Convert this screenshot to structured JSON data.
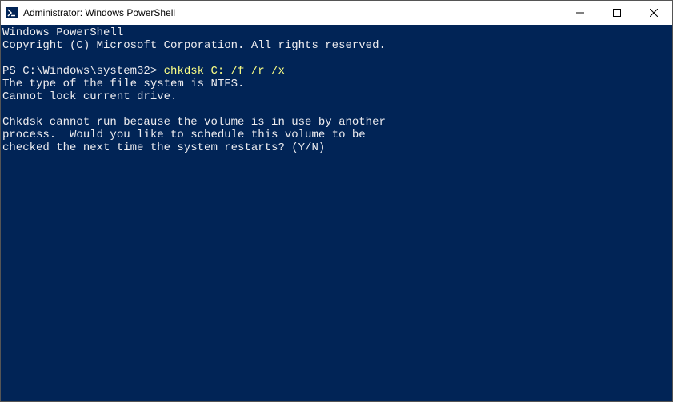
{
  "titlebar": {
    "title": "Administrator: Windows PowerShell"
  },
  "terminal": {
    "header1": "Windows PowerShell",
    "header2": "Copyright (C) Microsoft Corporation. All rights reserved.",
    "prompt": "PS C:\\Windows\\system32> ",
    "command": "chkdsk C: /f /r /x",
    "out1": "The type of the file system is NTFS.",
    "out2": "Cannot lock current drive.",
    "out3": "Chkdsk cannot run because the volume is in use by another",
    "out4": "process.  Would you like to schedule this volume to be",
    "out5": "checked the next time the system restarts? (Y/N)"
  }
}
